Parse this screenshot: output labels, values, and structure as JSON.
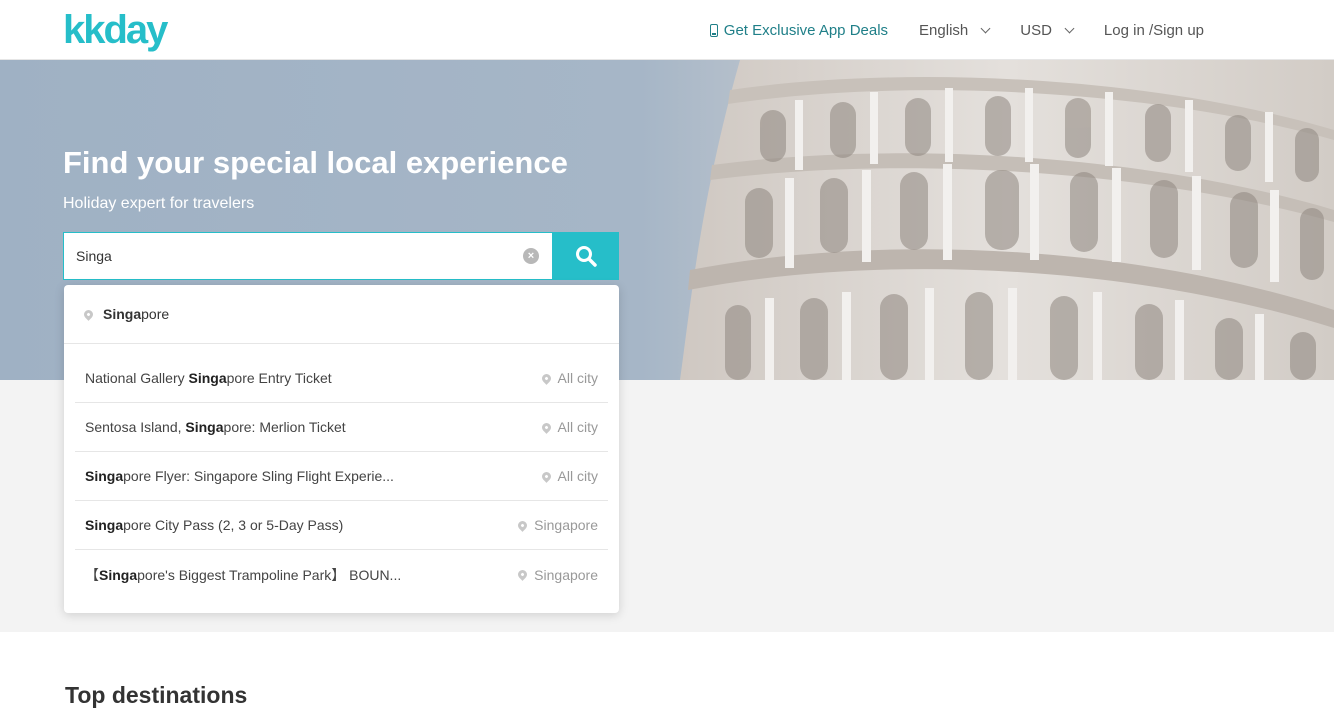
{
  "brand": {
    "logo_text": "kkday"
  },
  "header": {
    "app_deals": "Get Exclusive App Deals",
    "language": "English",
    "currency": "USD",
    "login": "Log in /Sign up"
  },
  "hero": {
    "title": "Find your special local experience",
    "subtitle": "Holiday expert for travelers"
  },
  "search": {
    "value": "Singa",
    "match": "Singa"
  },
  "dropdown": {
    "top_suggestion": {
      "bold": "Singa",
      "rest": "pore"
    },
    "results": [
      {
        "pre": "National Gallery ",
        "bold": "Singa",
        "post": "pore Entry Ticket",
        "city": "All city"
      },
      {
        "pre": "Sentosa Island, ",
        "bold": "Singa",
        "post": "pore: Merlion Ticket",
        "city": "All city"
      },
      {
        "pre": "",
        "bold": "Singa",
        "post": "pore Flyer: Singapore Sling Flight Experie...",
        "city": "All city"
      },
      {
        "pre": "",
        "bold": "Singa",
        "post": "pore City Pass (2, 3 or 5-Day Pass)",
        "city": "Singapore"
      },
      {
        "pre": "【",
        "bold": "Singa",
        "post": "pore's Biggest Trampoline Park】 BOUN...",
        "city": "Singapore"
      }
    ]
  },
  "sections": {
    "top_destinations": "Top destinations"
  },
  "colors": {
    "accent": "#26bec9",
    "deals_text": "#1f7f88",
    "band": "#f3f3f3"
  },
  "icons": {
    "phone": "phone-icon",
    "chevron": "chevron-down-icon",
    "clear": "clear-icon",
    "search": "search-icon",
    "pin": "map-pin-icon"
  }
}
